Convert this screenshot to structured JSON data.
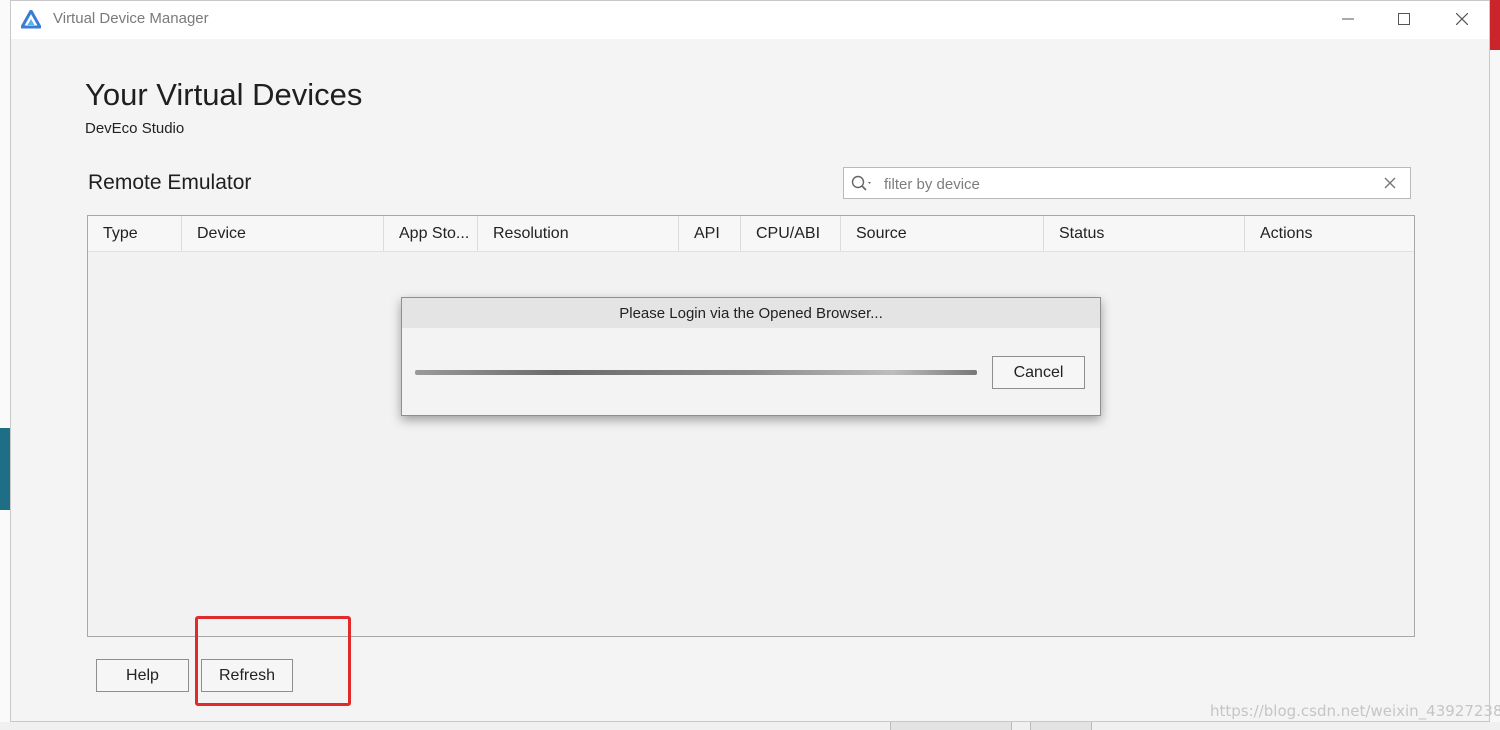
{
  "window": {
    "title": "Virtual Device Manager"
  },
  "page": {
    "heading": "Your Virtual Devices",
    "subheading": "DevEco Studio",
    "section_title": "Remote Emulator"
  },
  "search": {
    "placeholder": "filter by device",
    "value": ""
  },
  "table": {
    "columns": [
      "Type",
      "Device",
      "App Sto...",
      "Resolution",
      "API",
      "CPU/ABI",
      "Source",
      "Status",
      "Actions"
    ],
    "rows": []
  },
  "dialog": {
    "title": "Please Login via the Opened Browser...",
    "cancel_label": "Cancel",
    "progress": "indeterminate"
  },
  "footer": {
    "help_label": "Help",
    "refresh_label": "Refresh"
  },
  "watermark": "https://blog.csdn.net/weixin_43927238",
  "icons": {
    "app": "deveco-logo-icon",
    "search": "search-icon",
    "clear": "close-icon"
  },
  "colors": {
    "highlight": "#e12a2a",
    "logo": "#3a7bd5"
  }
}
